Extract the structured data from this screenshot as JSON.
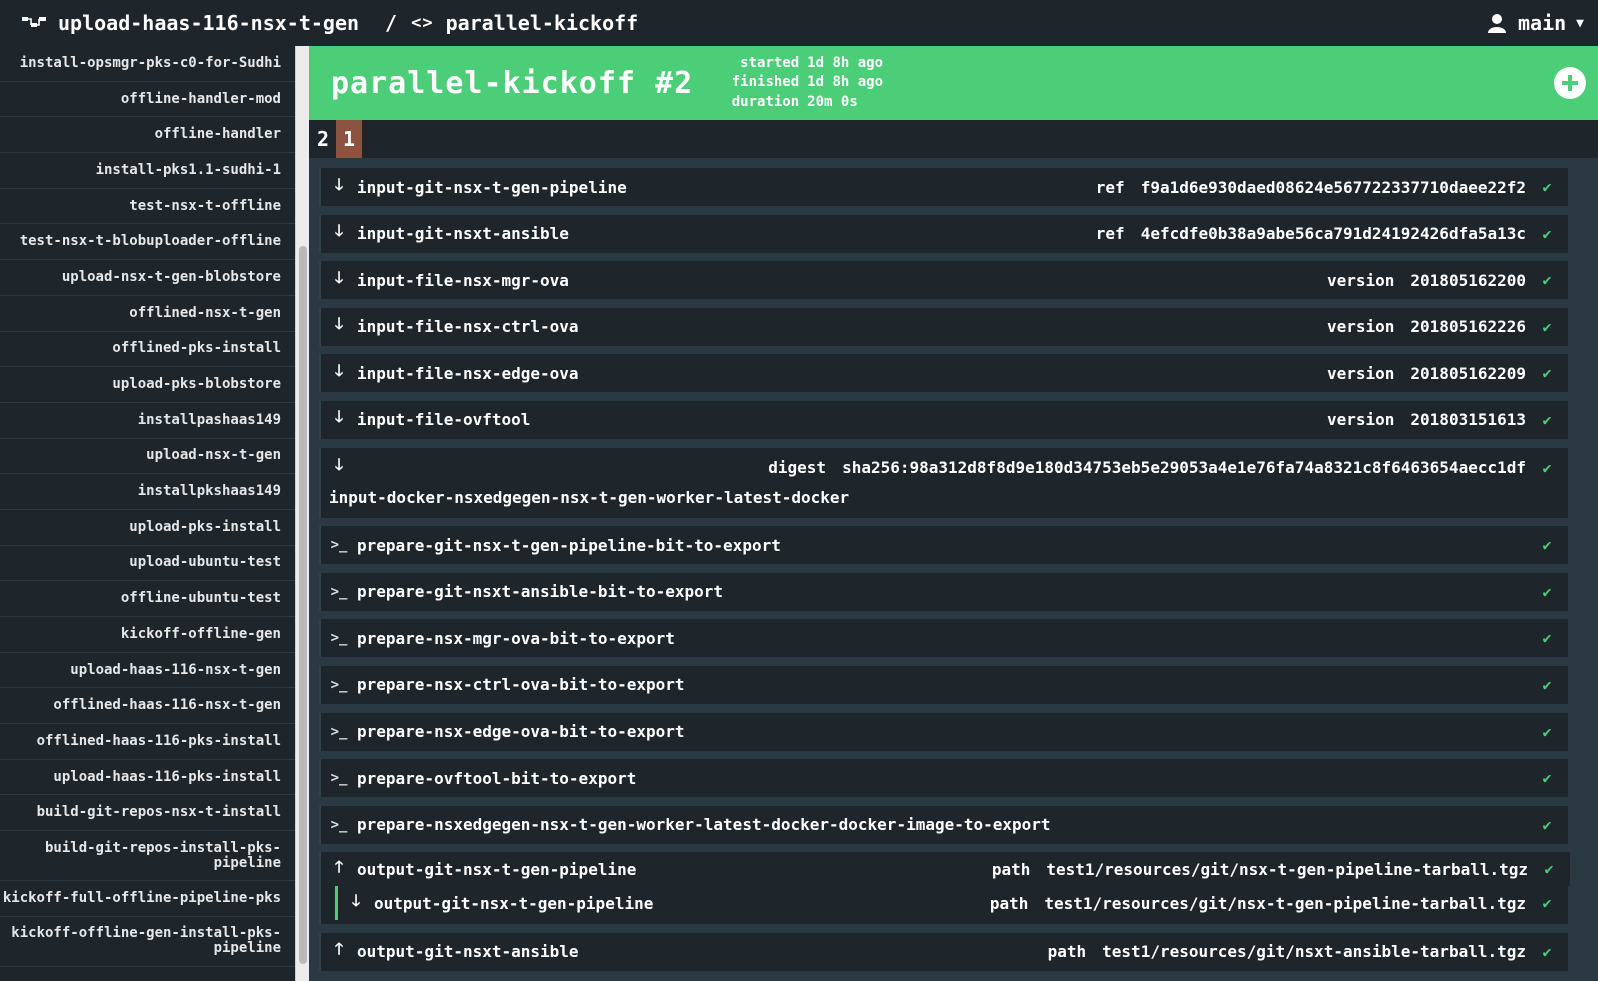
{
  "topbar": {
    "pipeline_name": "upload-haas-116-nsx-t-gen",
    "separator": "/",
    "job_icon": "<>",
    "job_name": "parallel-kickoff",
    "user": "main"
  },
  "sidebar": {
    "items": [
      {
        "label": "install-opsmgr-pks-c0-for-Sudhi"
      },
      {
        "label": "offline-handler-mod"
      },
      {
        "label": "offline-handler"
      },
      {
        "label": "install-pks1.1-sudhi-1"
      },
      {
        "label": "test-nsx-t-offline"
      },
      {
        "label": "test-nsx-t-blobuploader-offline"
      },
      {
        "label": "upload-nsx-t-gen-blobstore"
      },
      {
        "label": "offlined-nsx-t-gen"
      },
      {
        "label": "offlined-pks-install"
      },
      {
        "label": "upload-pks-blobstore"
      },
      {
        "label": "installpashaas149"
      },
      {
        "label": "upload-nsx-t-gen"
      },
      {
        "label": "installpkshaas149"
      },
      {
        "label": "upload-pks-install"
      },
      {
        "label": "upload-ubuntu-test"
      },
      {
        "label": "offline-ubuntu-test"
      },
      {
        "label": "kickoff-offline-gen"
      },
      {
        "label": "upload-haas-116-nsx-t-gen"
      },
      {
        "label": "offlined-haas-116-nsx-t-gen"
      },
      {
        "label": "offlined-haas-116-pks-install"
      },
      {
        "label": "upload-haas-116-pks-install"
      },
      {
        "label": "build-git-repos-nsx-t-install"
      },
      {
        "line1": "build-git-repos-install-pks-",
        "line2": "pipeline"
      },
      {
        "label": "kickoff-full-offline-pipeline-pks"
      },
      {
        "line1": "kickoff-offline-gen-install-pks-",
        "line2": "pipeline"
      }
    ]
  },
  "build": {
    "title": "parallel-kickoff #2",
    "started_label": "started",
    "started_value": "1d 8h ago",
    "finished_label": "finished",
    "finished_value": "1d 8h ago",
    "duration_label": "duration",
    "duration_value": "20m 0s",
    "status_color": "#4bce77"
  },
  "tabs": [
    {
      "label": "2",
      "status": "succeeded"
    },
    {
      "label": "1",
      "status": "errored",
      "color": "#8b5340"
    }
  ],
  "steps": {
    "gets": [
      {
        "name": "input-git-nsx-t-gen-pipeline",
        "key": "ref",
        "value": "f9a1d6e930daed08624e567722337710daee22f2"
      },
      {
        "name": "input-git-nsxt-ansible",
        "key": "ref",
        "value": "4efcdfe0b38a9abe56ca791d24192426dfa5a13c"
      },
      {
        "name": "input-file-nsx-mgr-ova",
        "key": "version",
        "value": "201805162200"
      },
      {
        "name": "input-file-nsx-ctrl-ova",
        "key": "version",
        "value": "201805162226"
      },
      {
        "name": "input-file-nsx-edge-ova",
        "key": "version",
        "value": "201805162209"
      },
      {
        "name": "input-file-ovftool",
        "key": "version",
        "value": "201803151613"
      }
    ],
    "docker_get": {
      "name": "input-docker-nsxedgegen-nsx-t-gen-worker-latest-docker",
      "key": "digest",
      "value": "sha256:98a312d8f8d9e180d34753eb5e29053a4e1e76fa74a8321c8f6463654aecc1df"
    },
    "tasks": [
      {
        "name": "prepare-git-nsx-t-gen-pipeline-bit-to-export"
      },
      {
        "name": "prepare-git-nsxt-ansible-bit-to-export"
      },
      {
        "name": "prepare-nsx-mgr-ova-bit-to-export"
      },
      {
        "name": "prepare-nsx-ctrl-ova-bit-to-export"
      },
      {
        "name": "prepare-nsx-edge-ova-bit-to-export"
      },
      {
        "name": "prepare-ovftool-bit-to-export"
      },
      {
        "name": "prepare-nsxedgegen-nsx-t-gen-worker-latest-docker-docker-image-to-export"
      }
    ],
    "puts": [
      {
        "name": "output-git-nsx-t-gen-pipeline",
        "key": "path",
        "value": "test1/resources/git/nsx-t-gen-pipeline-tarball.tgz",
        "implicit_get": {
          "name": "output-git-nsx-t-gen-pipeline",
          "key": "path",
          "value": "test1/resources/git/nsx-t-gen-pipeline-tarball.tgz"
        }
      },
      {
        "name": "output-git-nsxt-ansible",
        "key": "path",
        "value": "test1/resources/git/nsxt-ansible-tarball.tgz"
      }
    ]
  },
  "icons": {
    "down_arrow": "🡓",
    "up_arrow": "🡑",
    "task_prompt": ">_",
    "check": "✔"
  }
}
